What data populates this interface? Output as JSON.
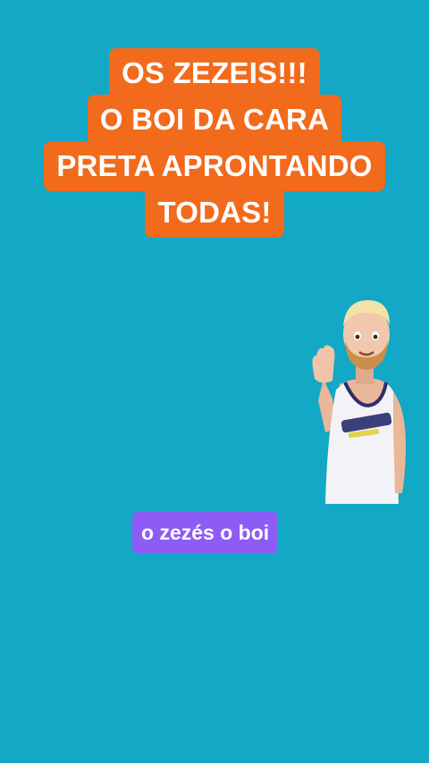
{
  "title": {
    "lines": [
      "OS ZEZEIS!!!",
      "O BOI DA CARA",
      "PRETA APRONTANDO",
      "TODAS!"
    ],
    "background_color": "#f26a1b"
  },
  "caption": {
    "text": "o zezés o boi",
    "background_color": "#8d5cf6"
  },
  "avatar": {
    "icon": "waving-avatar-icon"
  },
  "background_color": "#12a8c6"
}
